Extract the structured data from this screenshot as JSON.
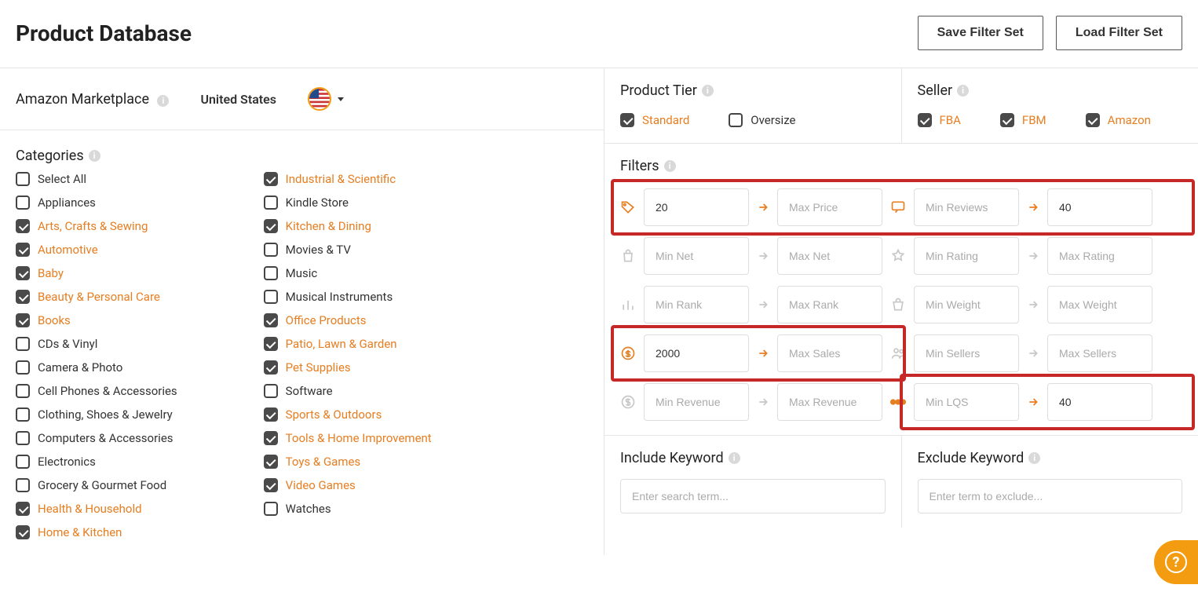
{
  "header": {
    "title": "Product Database",
    "save_btn": "Save Filter Set",
    "load_btn": "Load Filter Set"
  },
  "marketplace": {
    "label": "Amazon Marketplace",
    "country": "United States"
  },
  "categories": {
    "title": "Categories",
    "col1": [
      {
        "label": "Select All",
        "checked": false
      },
      {
        "label": "Appliances",
        "checked": false
      },
      {
        "label": "Arts, Crafts & Sewing",
        "checked": true
      },
      {
        "label": "Automotive",
        "checked": true
      },
      {
        "label": "Baby",
        "checked": true
      },
      {
        "label": "Beauty & Personal Care",
        "checked": true
      },
      {
        "label": "Books",
        "checked": true
      },
      {
        "label": "CDs & Vinyl",
        "checked": false
      },
      {
        "label": "Camera & Photo",
        "checked": false
      },
      {
        "label": "Cell Phones & Accessories",
        "checked": false
      },
      {
        "label": "Clothing, Shoes & Jewelry",
        "checked": false
      },
      {
        "label": "Computers & Accessories",
        "checked": false
      },
      {
        "label": "Electronics",
        "checked": false
      },
      {
        "label": "Grocery & Gourmet Food",
        "checked": false
      },
      {
        "label": "Health & Household",
        "checked": true
      },
      {
        "label": "Home & Kitchen",
        "checked": true
      }
    ],
    "col2": [
      {
        "label": "Industrial & Scientific",
        "checked": true
      },
      {
        "label": "Kindle Store",
        "checked": false
      },
      {
        "label": "Kitchen & Dining",
        "checked": true
      },
      {
        "label": "Movies & TV",
        "checked": false
      },
      {
        "label": "Music",
        "checked": false
      },
      {
        "label": "Musical Instruments",
        "checked": false
      },
      {
        "label": "Office Products",
        "checked": true
      },
      {
        "label": "Patio, Lawn & Garden",
        "checked": true
      },
      {
        "label": "Pet Supplies",
        "checked": true
      },
      {
        "label": "Software",
        "checked": false
      },
      {
        "label": "Sports & Outdoors",
        "checked": true
      },
      {
        "label": "Tools & Home Improvement",
        "checked": true
      },
      {
        "label": "Toys & Games",
        "checked": true
      },
      {
        "label": "Video Games",
        "checked": true
      },
      {
        "label": "Watches",
        "checked": false
      }
    ]
  },
  "product_tier": {
    "title": "Product Tier",
    "items": [
      {
        "label": "Standard",
        "checked": true
      },
      {
        "label": "Oversize",
        "checked": false
      }
    ]
  },
  "seller": {
    "title": "Seller",
    "items": [
      {
        "label": "FBA",
        "checked": true
      },
      {
        "label": "FBM",
        "checked": true
      },
      {
        "label": "Amazon",
        "checked": true
      }
    ]
  },
  "filters": {
    "title": "Filters",
    "rows": [
      {
        "icon": "tag",
        "min_ph": "",
        "min_val": "20",
        "max_ph": "Max Price",
        "max_val": "",
        "icon2": "chat",
        "min2_ph": "Min Reviews",
        "min2_val": "",
        "max2_ph": "",
        "max2_val": "40",
        "active": true
      },
      {
        "icon": "bag",
        "min_ph": "Min Net",
        "min_val": "",
        "max_ph": "Max Net",
        "max_val": "",
        "icon2": "star",
        "min2_ph": "Min Rating",
        "min2_val": "",
        "max2_ph": "Max Rating",
        "max2_val": "",
        "active": false
      },
      {
        "icon": "bars",
        "min_ph": "Min Rank",
        "min_val": "",
        "max_ph": "Max Rank",
        "max_val": "",
        "icon2": "bag2",
        "min2_ph": "Min Weight",
        "min2_val": "",
        "max2_ph": "Max Weight",
        "max2_val": "",
        "active": false
      },
      {
        "icon": "dollar",
        "min_ph": "",
        "min_val": "2000",
        "max_ph": "Max Sales",
        "max_val": "",
        "icon2": "people",
        "min2_ph": "Min Sellers",
        "min2_val": "",
        "max2_ph": "Max Sellers",
        "max2_val": "",
        "active": true,
        "left_only": true
      },
      {
        "icon": "refresh",
        "min_ph": "Min Revenue",
        "min_val": "",
        "max_ph": "Max Revenue",
        "max_val": "",
        "icon2": "lqs",
        "min2_ph": "Min LQS",
        "min2_val": "",
        "max2_ph": "",
        "max2_val": "40",
        "active": false,
        "right_active": true
      }
    ]
  },
  "keywords": {
    "include": {
      "title": "Include Keyword",
      "ph": "Enter search term..."
    },
    "exclude": {
      "title": "Exclude Keyword",
      "ph": "Enter term to exclude..."
    }
  }
}
